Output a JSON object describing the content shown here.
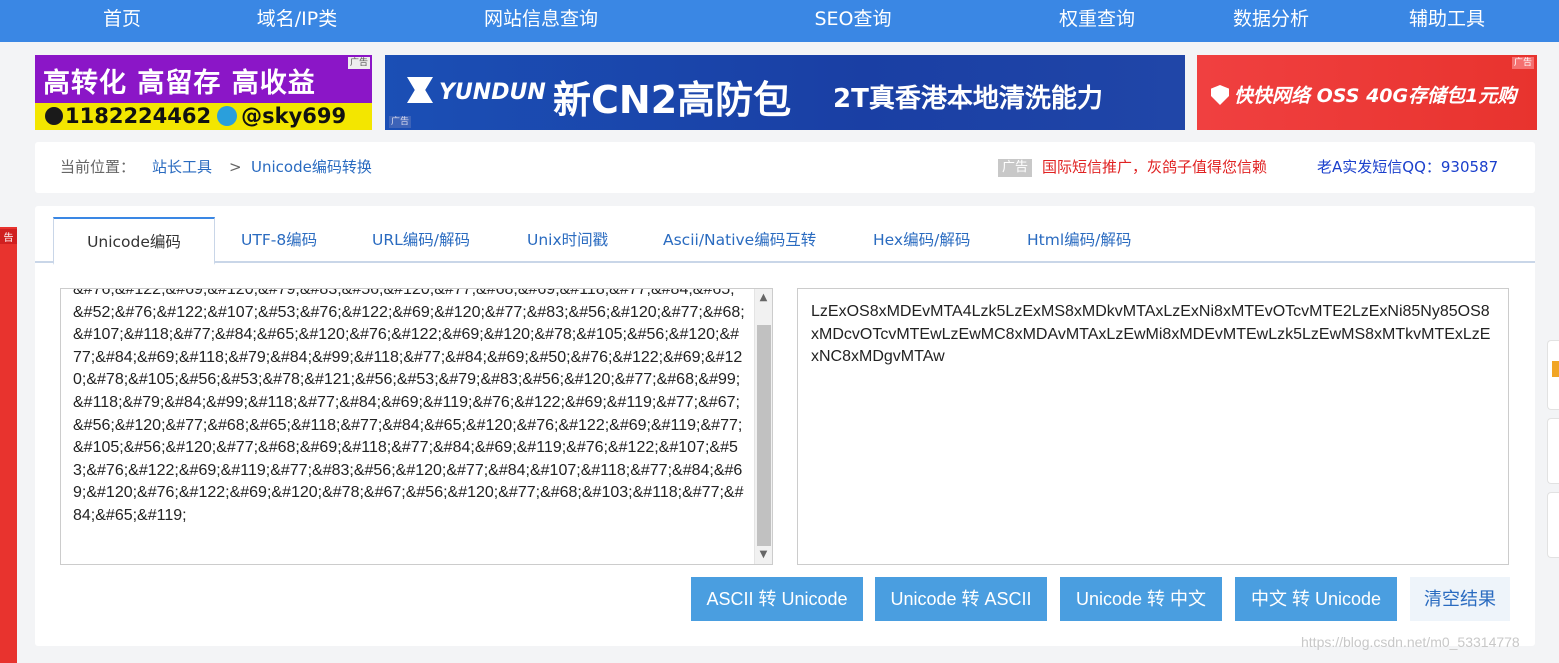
{
  "nav": {
    "items": [
      "首页",
      "域名/IP类",
      "网站信息查询",
      "SEO查询",
      "权重查询",
      "数据分析",
      "辅助工具"
    ]
  },
  "ads": {
    "ad1": {
      "line1": "高转化  高留存  高收益",
      "line2_qq": "1182224462",
      "line2_tg": "@sky699",
      "tag": "广告"
    },
    "ad2": {
      "brand": "YUNDUN",
      "headline": "新CN2高防包",
      "sub": "2T真香港本地清洗能力",
      "tag": "广告"
    },
    "ad3": {
      "text": "快快网络  OSS 40G存储包1元购",
      "tag": "广告"
    }
  },
  "breadcrumb": {
    "prefix": "当前位置：",
    "link1": "站长工具",
    "sep": ">",
    "link2": "Unicode编码转换",
    "ad_tag": "广告",
    "ad_text": "国际短信推广，灰鸽子值得您信赖",
    "ad_text2": "老A实发短信QQ：930587"
  },
  "tabs": [
    "Unicode编码",
    "UTF-8编码",
    "URL编码/解码",
    "Unix时间戳",
    "Ascii/Native编码互转",
    "Hex编码/解码",
    "Html编码/解码"
  ],
  "input_text": "&#76;&#122;&#69;&#120;&#79;&#83;&#56;&#120;&#77;&#68;&#69;&#118;&#77;&#84;&#65;&#52;&#76;&#122;&#107;&#53;&#76;&#122;&#69;&#120;&#77;&#83;&#56;&#120;&#77;&#68;&#107;&#118;&#77;&#84;&#65;&#120;&#76;&#122;&#69;&#120;&#78;&#105;&#56;&#120;&#77;&#84;&#69;&#118;&#79;&#84;&#99;&#118;&#77;&#84;&#69;&#50;&#76;&#122;&#69;&#120;&#78;&#105;&#56;&#53;&#78;&#121;&#56;&#53;&#79;&#83;&#56;&#120;&#77;&#68;&#99;&#118;&#79;&#84;&#99;&#118;&#77;&#84;&#69;&#119;&#76;&#122;&#69;&#119;&#77;&#67;&#56;&#120;&#77;&#68;&#65;&#118;&#77;&#84;&#65;&#120;&#76;&#122;&#69;&#119;&#77;&#105;&#56;&#120;&#77;&#68;&#69;&#118;&#77;&#84;&#69;&#119;&#76;&#122;&#107;&#53;&#76;&#122;&#69;&#119;&#77;&#83;&#56;&#120;&#77;&#84;&#107;&#118;&#77;&#84;&#69;&#120;&#76;&#122;&#69;&#120;&#78;&#67;&#56;&#120;&#77;&#68;&#103;&#118;&#77;&#84;&#65;&#119;",
  "output_text": "LzExOS8xMDEvMTA4Lzk5LzExMS8xMDkvMTAxLzExNi8xMTEvOTcvMTE2LzExNi85Ny85OS8xMDcvOTcvMTEwLzEwMC8xMDAvMTAxLzEwMi8xMDEvMTEwLzk5LzEwMS8xMTkvMTExLzExNC8xMDgvMTAw",
  "buttons": {
    "ascii_to_unicode": "ASCII 转 Unicode",
    "unicode_to_ascii": "Unicode 转 ASCII",
    "unicode_to_chinese": "Unicode 转 中文",
    "chinese_to_unicode": "中文 转 Unicode",
    "clear": "清空结果"
  },
  "side_left_tag": "告",
  "watermark": "https://blog.csdn.net/m0_53314778"
}
